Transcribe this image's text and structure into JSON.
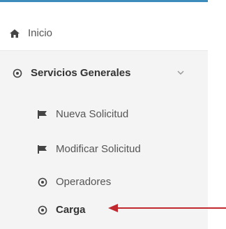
{
  "sidebar": {
    "home": {
      "label": "Inicio",
      "icon": "home-icon"
    },
    "section": {
      "label": "Servicios Generales",
      "icon": "circle-dot-icon",
      "expanded": true
    },
    "items": [
      {
        "label": "Nueva Solicitud",
        "icon": "flag-icon"
      },
      {
        "label": "Modificar Solicitud",
        "icon": "flag-icon"
      },
      {
        "label": "Operadores",
        "icon": "circle-dot-icon"
      },
      {
        "label": "Carga",
        "icon": "circle-dot-icon",
        "active": true
      }
    ]
  },
  "annotation": {
    "arrow_color": "#c0282d",
    "points_to": "Carga"
  },
  "colors": {
    "accent": "#3c8dbc",
    "sidebar_bg": "#f4f4f4",
    "text": "#555555"
  }
}
